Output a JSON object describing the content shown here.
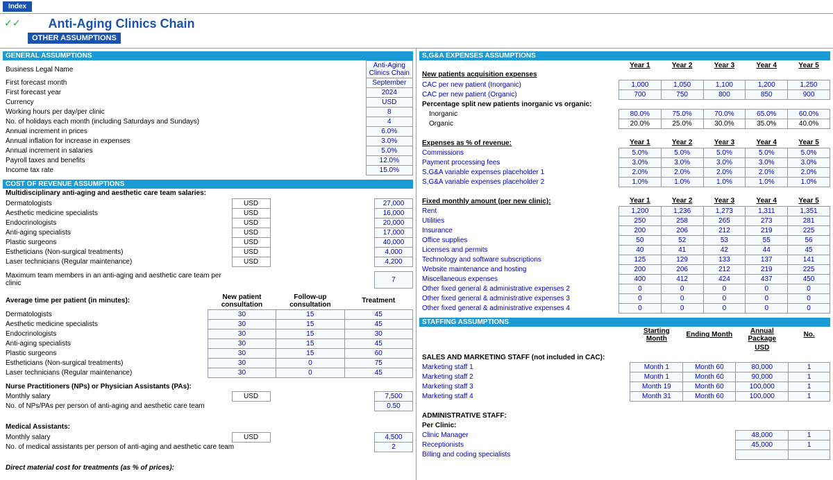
{
  "ui": {
    "index_button": "Index",
    "title": "Anti-Aging Clinics Chain",
    "other_assumptions": "OTHER ASSUMPTIONS"
  },
  "general": {
    "header": "GENERAL ASSUMPTIONS",
    "rows": [
      {
        "label": "Business Legal Name",
        "value": "Anti-Aging Clinics Chain"
      },
      {
        "label": "First forecast month",
        "value": "September"
      },
      {
        "label": "First forecast year",
        "value": "2024"
      },
      {
        "label": "Currency",
        "value": "USD"
      },
      {
        "label": "Working hours per day/per clinic",
        "value": "8"
      },
      {
        "label": "No. of holidays each month (including Saturdays and Sundays)",
        "value": "4"
      },
      {
        "label": "Annual increment in prices",
        "value": "6.0%"
      },
      {
        "label": "Annual inflation for increase in expenses",
        "value": "3.0%"
      },
      {
        "label": "Annual increment in salaries",
        "value": "5.0%"
      },
      {
        "label": "Payroll taxes and benefits",
        "value": "12.0%"
      },
      {
        "label": "Income tax rate",
        "value": "15.0%"
      }
    ]
  },
  "cost_rev": {
    "header": "COST OF REVENUE ASSUMPTIONS",
    "salaries_title": "Multidisciplinary anti-aging and aesthetic care team salaries:",
    "usd": "USD",
    "salaries": [
      {
        "role": "Dermatologists",
        "val": "27,000"
      },
      {
        "role": "Aesthetic medicine specialists",
        "val": "16,000"
      },
      {
        "role": "Endocrinologists",
        "val": "20,000"
      },
      {
        "role": "Anti-aging specialists",
        "val": "17,000"
      },
      {
        "role": "Plastic surgeons",
        "val": "40,000"
      },
      {
        "role": "Estheticians (Non-surgical treatments)",
        "val": "4,000"
      },
      {
        "role": "Laser technicians (Regular maintenance)",
        "val": "4,200"
      }
    ],
    "max_team_label": "Maximum team members in an anti-aging and aesthetic care team per clinic",
    "max_team_val": "7",
    "avg_time_title": "Average time per patient (in minutes):",
    "col_new": "New patient consultation",
    "col_follow": "Follow-up consultation",
    "col_treat": "Treatment",
    "times": [
      {
        "role": "Dermatologists",
        "n": "30",
        "f": "15",
        "t": "45"
      },
      {
        "role": "Aesthetic medicine specialists",
        "n": "30",
        "f": "15",
        "t": "45"
      },
      {
        "role": "Endocrinologists",
        "n": "30",
        "f": "15",
        "t": "30"
      },
      {
        "role": "Anti-aging specialists",
        "n": "30",
        "f": "15",
        "t": "45"
      },
      {
        "role": "Plastic surgeons",
        "n": "30",
        "f": "15",
        "t": "60"
      },
      {
        "role": "Estheticians (Non-surgical treatments)",
        "n": "30",
        "f": "0",
        "t": "75"
      },
      {
        "role": "Laser technicians (Regular maintenance)",
        "n": "30",
        "f": "0",
        "t": "45"
      }
    ],
    "np_title": "Nurse Practitioners (NPs) or Physician Assistants (PAs):",
    "np_monthly": "Monthly salary",
    "np_val": "7,500",
    "np_ratio": "No. of NPs/PAs per person of anti-aging and aesthetic care team",
    "np_ratio_val": "0.50",
    "ma_title": "Medical Assistants:",
    "ma_monthly": "Monthly salary",
    "ma_val": "4,500",
    "ma_ratio": "No. of medical assistants per person of anti-aging and aesthetic care team",
    "ma_ratio_val": "2",
    "direct_mat": "Direct material cost for treatments (as % of prices):"
  },
  "sga": {
    "header": "S,G&A EXPENSES ASSUMPTIONS",
    "years": [
      "Year 1",
      "Year 2",
      "Year 3",
      "Year 4",
      "Year 5"
    ],
    "acq_title": "New patients acquisition expenses",
    "cac_inorg": "CAC per new patient (Inorganic)",
    "cac_inorg_v": [
      "1,000",
      "1,050",
      "1,100",
      "1,200",
      "1,250"
    ],
    "cac_org": "CAC per new patient (Organic)",
    "cac_org_v": [
      "700",
      "750",
      "800",
      "850",
      "900"
    ],
    "split_title": "Percentage split new patients inorganic vs organic:",
    "inorg": "Inorganic",
    "inorg_v": [
      "80.0%",
      "75.0%",
      "70.0%",
      "65.0%",
      "60.0%"
    ],
    "org": "Organic",
    "org_v": [
      "20.0%",
      "25.0%",
      "30.0%",
      "35.0%",
      "40.0%"
    ],
    "exp_pct_title": "Expenses as % of revenue:",
    "exp_pct": [
      {
        "label": "Commissions",
        "v": [
          "5.0%",
          "5.0%",
          "5.0%",
          "5.0%",
          "5.0%"
        ]
      },
      {
        "label": "Payment processing fees",
        "v": [
          "3.0%",
          "3.0%",
          "3.0%",
          "3.0%",
          "3.0%"
        ]
      },
      {
        "label": "S,G&A variable expenses placeholder 1",
        "v": [
          "2.0%",
          "2.0%",
          "2.0%",
          "2.0%",
          "2.0%"
        ]
      },
      {
        "label": "S,G&A variable expenses placeholder 2",
        "v": [
          "1.0%",
          "1.0%",
          "1.0%",
          "1.0%",
          "1.0%"
        ]
      }
    ],
    "fixed_title": "Fixed monthly amount (per new clinic):",
    "fixed": [
      {
        "label": "Rent",
        "v": [
          "1,200",
          "1,236",
          "1,273",
          "1,311",
          "1,351"
        ]
      },
      {
        "label": "Utilities",
        "v": [
          "250",
          "258",
          "265",
          "273",
          "281"
        ]
      },
      {
        "label": "Insurance",
        "v": [
          "200",
          "206",
          "212",
          "219",
          "225"
        ]
      },
      {
        "label": "Office supplies",
        "v": [
          "50",
          "52",
          "53",
          "55",
          "56"
        ]
      },
      {
        "label": "Licenses and permits",
        "v": [
          "40",
          "41",
          "42",
          "44",
          "45"
        ]
      },
      {
        "label": "Technology and software subscriptions",
        "v": [
          "125",
          "129",
          "133",
          "137",
          "141"
        ]
      },
      {
        "label": "Website maintenance and hosting",
        "v": [
          "200",
          "206",
          "212",
          "219",
          "225"
        ]
      },
      {
        "label": "Miscellaneous expenses",
        "v": [
          "400",
          "412",
          "424",
          "437",
          "450"
        ]
      },
      {
        "label": "Other fixed general & administrative expenses 2",
        "v": [
          "0",
          "0",
          "0",
          "0",
          "0"
        ]
      },
      {
        "label": "Other fixed general & administrative expenses 3",
        "v": [
          "0",
          "0",
          "0",
          "0",
          "0"
        ]
      },
      {
        "label": "Other fixed general & administrative expenses 4",
        "v": [
          "0",
          "0",
          "0",
          "0",
          "0"
        ]
      }
    ]
  },
  "staffing": {
    "header": "STAFFING ASSUMPTIONS",
    "col_start": "Starting Month",
    "col_end": "Ending Month",
    "col_pkg": "Annual Package",
    "col_no": "No.",
    "usd": "USD",
    "sm_title": "SALES AND MARKETING STAFF (not included in CAC):",
    "sm": [
      {
        "label": "Marketing staff 1",
        "s": "Month 1",
        "e": "Month 60",
        "p": "80,000",
        "n": "1"
      },
      {
        "label": "Marketing staff 2",
        "s": "Month 1",
        "e": "Month 60",
        "p": "90,000",
        "n": "1"
      },
      {
        "label": "Marketing staff 3",
        "s": "Month 19",
        "e": "Month 60",
        "p": "100,000",
        "n": "1"
      },
      {
        "label": "Marketing staff 4",
        "s": "Month 31",
        "e": "Month 60",
        "p": "100,000",
        "n": "1"
      }
    ],
    "admin_title": "ADMINISTRATIVE STAFF:",
    "per_clinic": "Per Clinic:",
    "admin": [
      {
        "label": "Clinic Manager",
        "p": "48,000",
        "n": "1"
      },
      {
        "label": "Receptionists",
        "p": "45,000",
        "n": "1"
      },
      {
        "label": "Billing and coding specialists",
        "p": "",
        "n": ""
      }
    ]
  }
}
